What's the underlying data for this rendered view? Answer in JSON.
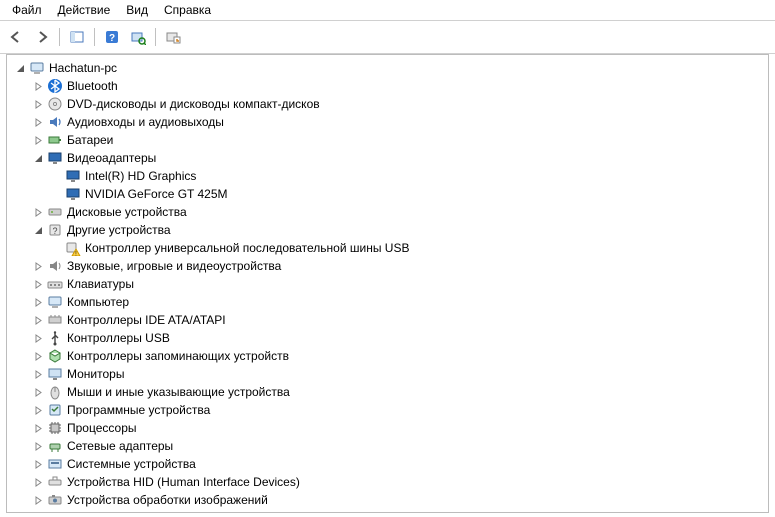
{
  "menu": {
    "file": "Файл",
    "action": "Действие",
    "view": "Вид",
    "help": "Справка"
  },
  "toolbar": {
    "back": "back",
    "forward": "forward",
    "show_hide_tree": "show-hide-tree",
    "help": "help",
    "scan": "scan-hardware",
    "properties": "properties"
  },
  "tree": [
    {
      "id": "root",
      "depth": 0,
      "expander": "open",
      "icon": "computer",
      "label": "Hachatun-pc"
    },
    {
      "id": "bluetooth",
      "depth": 1,
      "expander": "closed",
      "icon": "bluetooth",
      "label": "Bluetooth"
    },
    {
      "id": "dvd",
      "depth": 1,
      "expander": "closed",
      "icon": "disc",
      "label": "DVD-дисководы и дисководы компакт-дисков"
    },
    {
      "id": "audio",
      "depth": 1,
      "expander": "closed",
      "icon": "audio",
      "label": "Аудиовходы и аудиовыходы"
    },
    {
      "id": "battery",
      "depth": 1,
      "expander": "closed",
      "icon": "battery",
      "label": "Батареи"
    },
    {
      "id": "display",
      "depth": 1,
      "expander": "open",
      "icon": "display",
      "label": "Видеоадаптеры"
    },
    {
      "id": "intel",
      "depth": 2,
      "expander": "none",
      "icon": "display",
      "label": "Intel(R) HD Graphics"
    },
    {
      "id": "nvidia",
      "depth": 2,
      "expander": "none",
      "icon": "display",
      "label": "NVIDIA GeForce GT 425M"
    },
    {
      "id": "disk",
      "depth": 1,
      "expander": "closed",
      "icon": "disk",
      "label": "Дисковые устройства"
    },
    {
      "id": "other",
      "depth": 1,
      "expander": "open",
      "icon": "other",
      "label": "Другие устройства"
    },
    {
      "id": "usbctrl",
      "depth": 2,
      "expander": "none",
      "icon": "warning",
      "label": "Контроллер универсальной последовательной шины USB"
    },
    {
      "id": "sound",
      "depth": 1,
      "expander": "closed",
      "icon": "sound",
      "label": "Звуковые, игровые и видеоустройства"
    },
    {
      "id": "keyboard",
      "depth": 1,
      "expander": "closed",
      "icon": "keyboard",
      "label": "Клавиатуры"
    },
    {
      "id": "computer",
      "depth": 1,
      "expander": "closed",
      "icon": "computer-sm",
      "label": "Компьютер"
    },
    {
      "id": "ide",
      "depth": 1,
      "expander": "closed",
      "icon": "ide",
      "label": "Контроллеры IDE ATA/ATAPI"
    },
    {
      "id": "usb",
      "depth": 1,
      "expander": "closed",
      "icon": "usb",
      "label": "Контроллеры USB"
    },
    {
      "id": "storage",
      "depth": 1,
      "expander": "closed",
      "icon": "storage",
      "label": "Контроллеры запоминающих устройств"
    },
    {
      "id": "monitor",
      "depth": 1,
      "expander": "closed",
      "icon": "monitor",
      "label": "Мониторы"
    },
    {
      "id": "mouse",
      "depth": 1,
      "expander": "closed",
      "icon": "mouse",
      "label": "Мыши и иные указывающие устройства"
    },
    {
      "id": "software",
      "depth": 1,
      "expander": "closed",
      "icon": "software",
      "label": "Программные устройства"
    },
    {
      "id": "cpu",
      "depth": 1,
      "expander": "closed",
      "icon": "cpu",
      "label": "Процессоры"
    },
    {
      "id": "network",
      "depth": 1,
      "expander": "closed",
      "icon": "network",
      "label": "Сетевые адаптеры"
    },
    {
      "id": "system",
      "depth": 1,
      "expander": "closed",
      "icon": "system",
      "label": "Системные устройства"
    },
    {
      "id": "hid",
      "depth": 1,
      "expander": "closed",
      "icon": "hid",
      "label": "Устройства HID (Human Interface Devices)"
    },
    {
      "id": "imaging",
      "depth": 1,
      "expander": "closed",
      "icon": "imaging",
      "label": "Устройства обработки изображений"
    }
  ]
}
